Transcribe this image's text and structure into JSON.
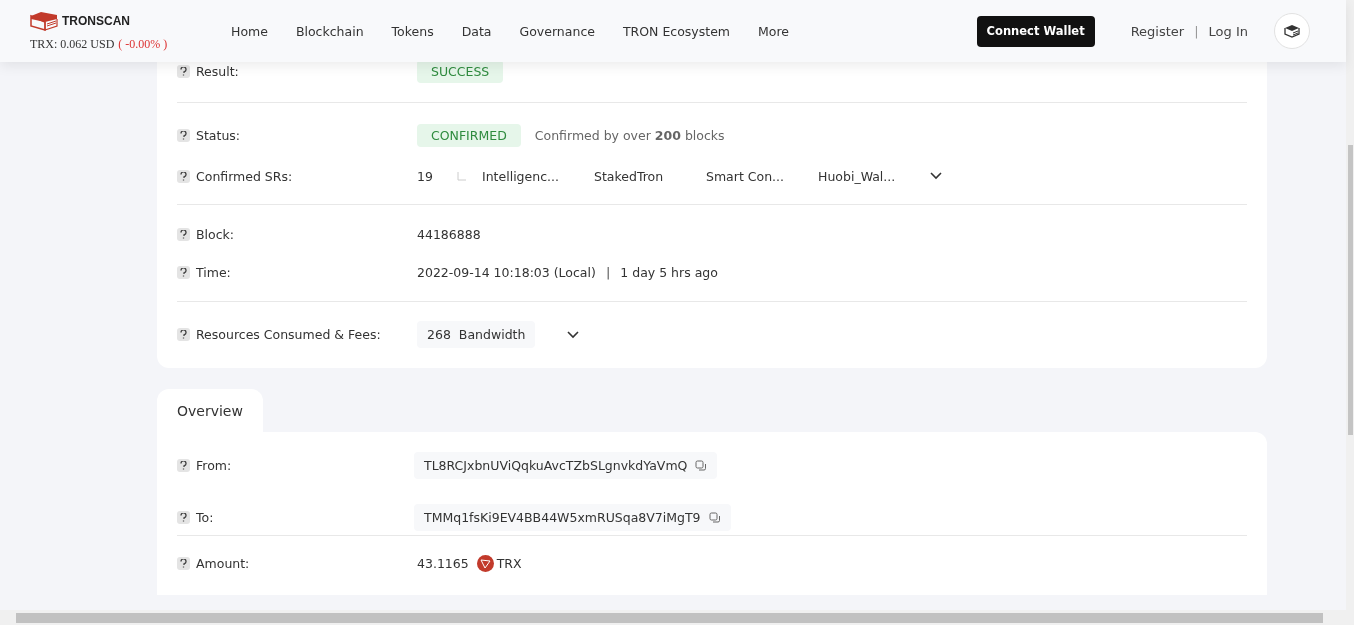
{
  "header": {
    "brand": "TRONSCAN",
    "price": "TRX: 0.062 USD",
    "price_change": "( -0.00% )",
    "nav": [
      "Home",
      "Blockchain",
      "Tokens",
      "Data",
      "Governance",
      "TRON Ecosystem",
      "More"
    ],
    "connect_button": "Connect Wallet",
    "register": "Register",
    "separator": "|",
    "login": "Log In"
  },
  "summary_rows": [
    {
      "kind": "badge",
      "label": "Result:",
      "value": "SUCCESS",
      "divider": true
    },
    {
      "kind": "status",
      "label": "Status:",
      "value": "CONFIRMED",
      "note": "Confirmed by over **200** blocks"
    },
    {
      "kind": "srs",
      "label": "Confirmed SRs:",
      "count": "19",
      "items": [
        "Intelligenc...",
        "StakedTron",
        "Smart Con...",
        "Huobi_Wal..."
      ],
      "divider": true
    },
    {
      "kind": "text",
      "label": "Block:",
      "value": "44186888"
    },
    {
      "kind": "time",
      "label": "Time:",
      "value": "2022-09-14 10:18:03 (Local)",
      "separator": "|",
      "ago": "1 day 5 hrs ago",
      "divider": true
    },
    {
      "kind": "resource",
      "label": "Resources Consumed & Fees:",
      "amount": "268",
      "unit": "Bandwidth"
    }
  ],
  "tab": {
    "label": "Overview",
    "selected": true
  },
  "overview_rows": [
    {
      "kind": "address",
      "label": "From:",
      "value": "TL8RCJxbnUViQqkuAvcTZbSLgnvkdYaVmQ"
    },
    {
      "kind": "address",
      "label": "To:",
      "value": "TMMq1fsKi9EV4BB44W5xmRUSqa8V7iMgT9",
      "divider": true
    },
    {
      "kind": "amount",
      "label": "Amount:",
      "value": "43.1165",
      "token": "TRX"
    }
  ]
}
